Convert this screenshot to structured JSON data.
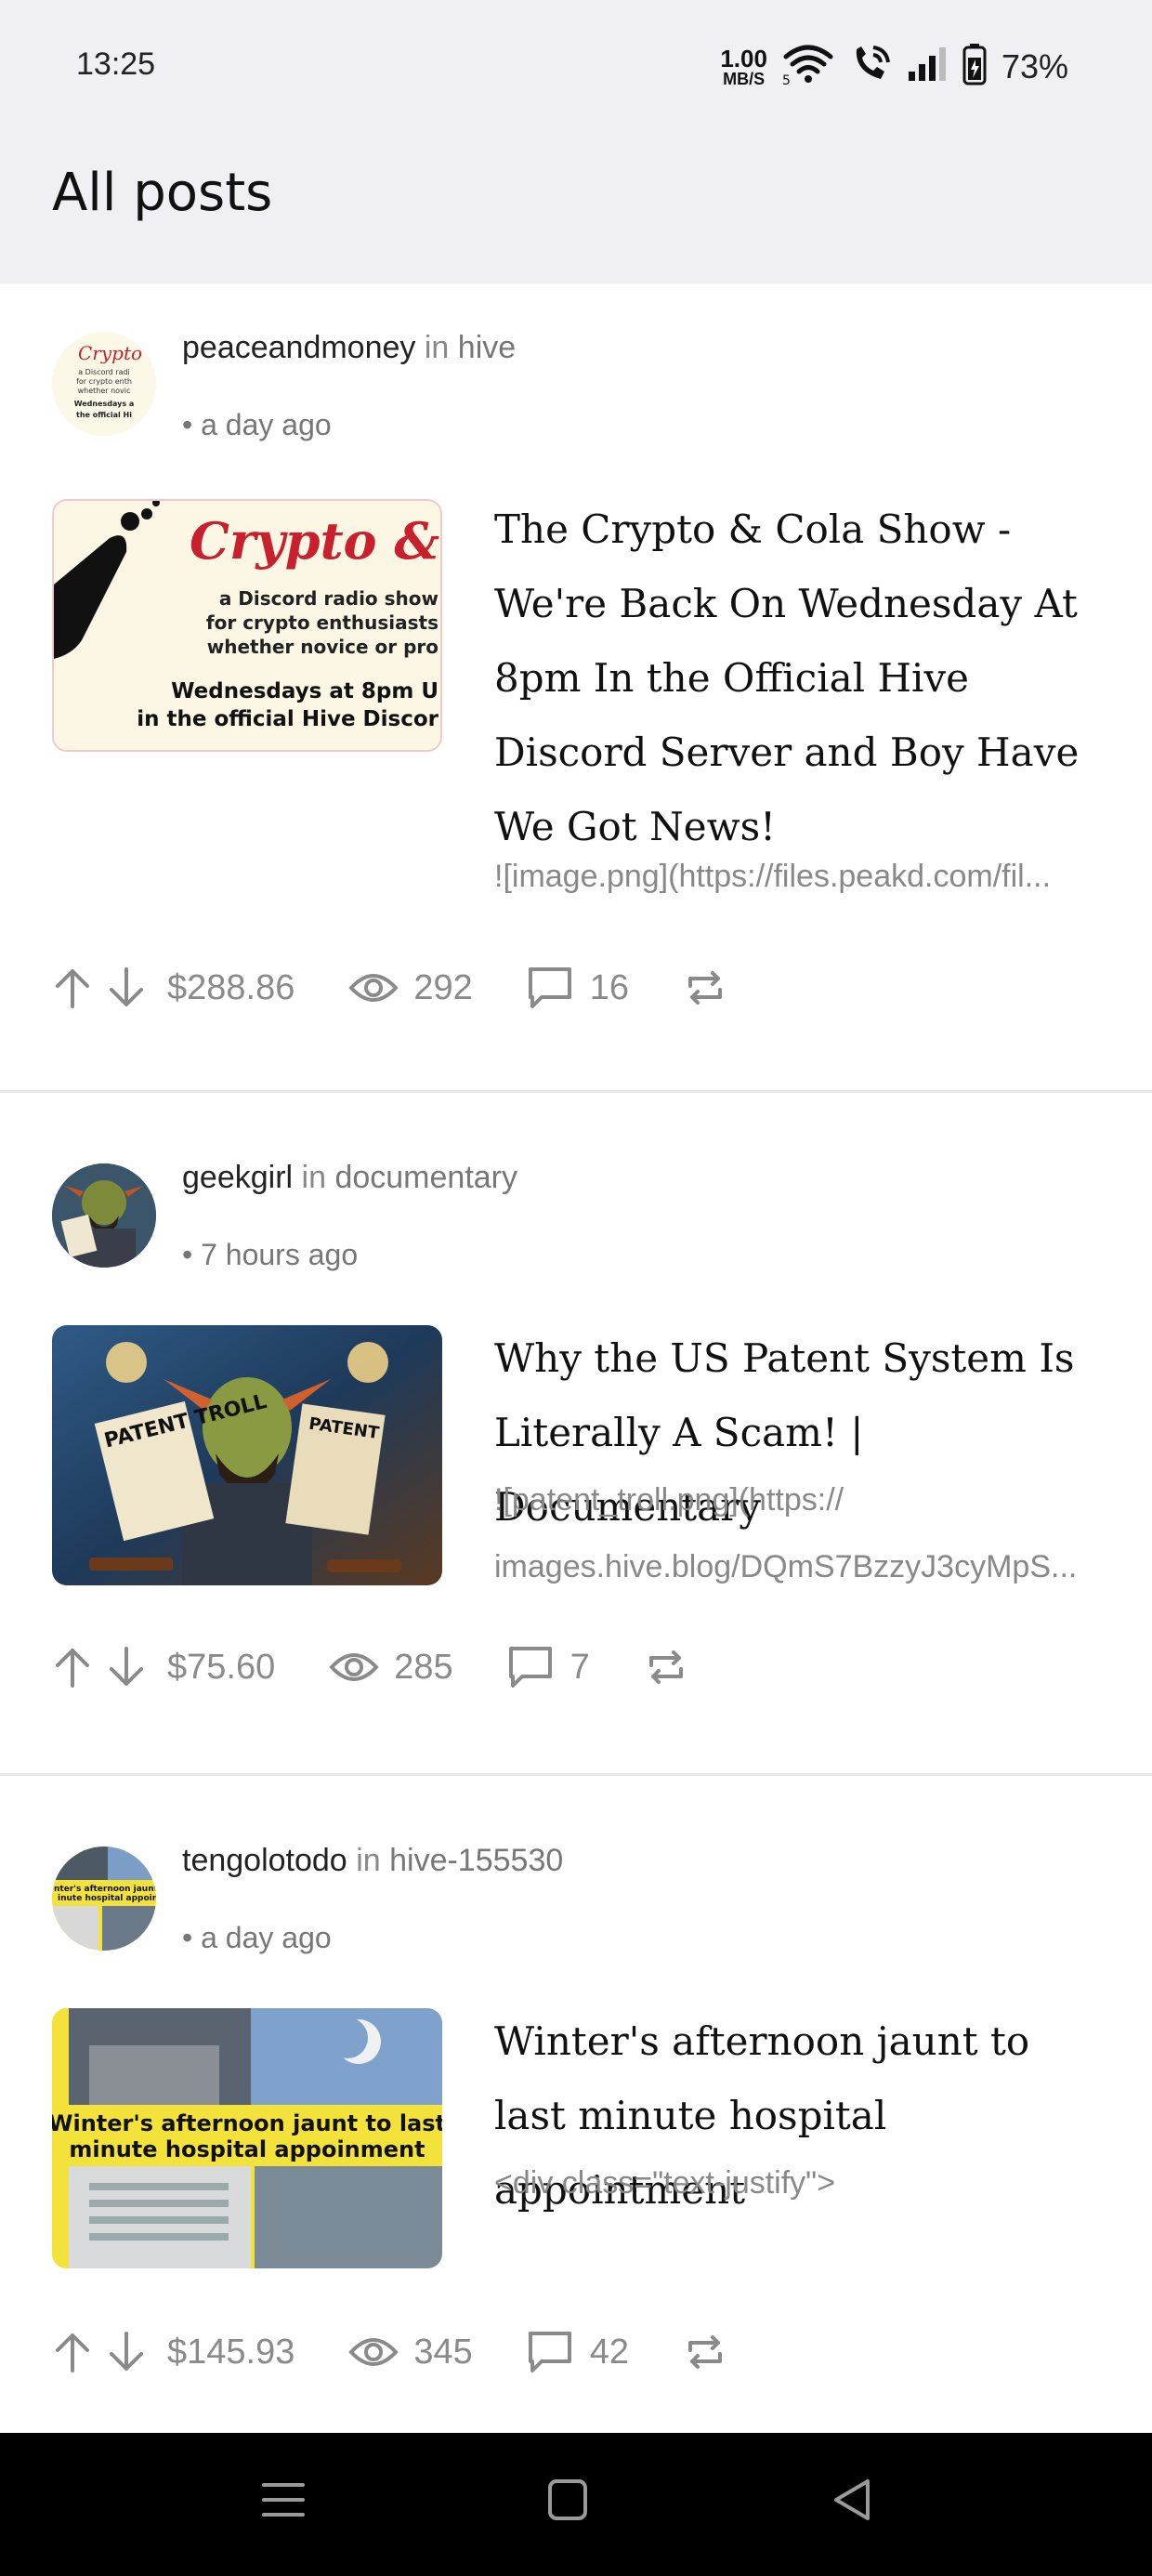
{
  "status": {
    "time": "13:25",
    "speed_value": "1.00",
    "speed_unit": "MB/S",
    "battery": "73%",
    "icons": [
      "wifi-icon",
      "wifi-call-icon",
      "signal-icon",
      "battery-icon"
    ]
  },
  "header": {
    "title": "All posts"
  },
  "posts": [
    {
      "author": "peaceandmoney",
      "in": "in",
      "community": "hive",
      "time": "• a day ago",
      "title": "The Crypto & Cola Show - We're Back On Wednesday At 8pm In the Official Hive Discord Server and Boy Have We Got News!",
      "excerpt": [
        "![image.png](https://files.peakd.com/fil..."
      ],
      "thumb": {
        "heading": "Crypto & Co",
        "line1": "a Discord radio show",
        "line2": "for crypto enthusiasts",
        "line3": "whether novice or pro",
        "line4": "Wednesdays at 8pm U",
        "line5": "in the official Hive Discor"
      },
      "avatar": {
        "heading": "Crypto &",
        "l1": "a Discord radi",
        "l2": "for crypto enth",
        "l3": "whether novic",
        "l4": "Wednesdays a",
        "l5": "the official Hi"
      },
      "payout": "$288.86",
      "views": "292",
      "comments": "16"
    },
    {
      "author": "geekgirl",
      "in": "in",
      "community": "documentary",
      "time": "• 7 hours ago",
      "title": "Why the US Patent System Is Literally A Scam! | Documentary",
      "excerpt": [
        "![patent_troll.png](https://",
        "images.hive.blog/DQmS7BzzyJ3cyMpS..."
      ],
      "thumb": {
        "sign": "PATENT TROLL",
        "sign2": "PATENT"
      },
      "payout": "$75.60",
      "views": "285",
      "comments": "7"
    },
    {
      "author": "tengolotodo",
      "in": "in",
      "community": "hive-155530",
      "time": "• a day ago",
      "title": "Winter's afternoon  jaunt to last minute hospital appointment",
      "excerpt": [
        "<div class=\"text-justify\">"
      ],
      "thumb": {
        "caption1": "Winter's afternoon  jaunt to last",
        "caption2": "minute hospital appoinment"
      },
      "avatar": {
        "c1": "nter's afternoon  jaunt to la",
        "c2": "inute hospital appoinm"
      },
      "payout": "$145.93",
      "views": "345",
      "comments": "42"
    }
  ],
  "colors": {
    "header_bg": "#efeff4",
    "accent_red": "#c8202c",
    "action_gray": "#8a8a8a",
    "yellow": "#f2e23a"
  }
}
